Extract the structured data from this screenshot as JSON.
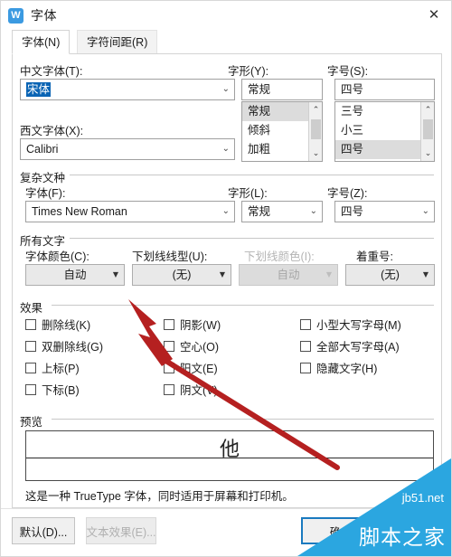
{
  "window": {
    "title": "字体",
    "icon": "wps-writer-icon",
    "close_label": "✕"
  },
  "tabs": [
    {
      "label": "字体(N)",
      "active": true
    },
    {
      "label": "字符间距(R)",
      "active": false
    }
  ],
  "chinese_font": {
    "label": "中文字体(T):",
    "value": "宋体",
    "selected": true
  },
  "latin_font": {
    "label": "西文字体(X):",
    "value": "Calibri"
  },
  "font_style": {
    "label": "字形(Y):",
    "value": "常规",
    "options": [
      "常规",
      "倾斜",
      "加粗"
    ],
    "selected_index": 0
  },
  "font_size": {
    "label": "字号(S):",
    "value": "四号",
    "options": [
      "三号",
      "小三",
      "四号"
    ],
    "selected_index": 2
  },
  "complex_script": {
    "group_label": "复杂文种",
    "font": {
      "label": "字体(F):",
      "value": "Times New Roman"
    },
    "style": {
      "label": "字形(L):",
      "value": "常规"
    },
    "size": {
      "label": "字号(Z):",
      "value": "四号"
    }
  },
  "all_text": {
    "group_label": "所有文字",
    "font_color": {
      "label": "字体颜色(C):",
      "value": "自动",
      "disabled": false
    },
    "underline_style": {
      "label": "下划线线型(U):",
      "value": "(无)",
      "disabled": false
    },
    "underline_color": {
      "label": "下划线颜色(I):",
      "value": "自动",
      "disabled": true
    },
    "emphasis_mark": {
      "label": "着重号:",
      "value": "(无)",
      "disabled": false
    }
  },
  "effects": {
    "group_label": "效果",
    "column1": [
      {
        "label": "删除线(K)",
        "checked": false
      },
      {
        "label": "双删除线(G)",
        "checked": false
      },
      {
        "label": "上标(P)",
        "checked": false
      },
      {
        "label": "下标(B)",
        "checked": false
      }
    ],
    "column2": [
      {
        "label": "阴影(W)",
        "checked": false
      },
      {
        "label": "空心(O)",
        "checked": false
      },
      {
        "label": "阳文(E)",
        "checked": false
      },
      {
        "label": "阴文(V)",
        "checked": false
      }
    ],
    "column3": [
      {
        "label": "小型大写字母(M)",
        "checked": false
      },
      {
        "label": "全部大写字母(A)",
        "checked": false
      },
      {
        "label": "隐藏文字(H)",
        "checked": false
      }
    ]
  },
  "preview": {
    "group_label": "预览",
    "sample_text": "他",
    "note": "这是一种 TrueType 字体，同时适用于屏幕和打印机。"
  },
  "footer": {
    "default_button": "默认(D)...",
    "text_effects_button": "文本效果(E)...",
    "ok_button": "确"
  },
  "watermark": {
    "site": "jb51.net",
    "name": "脚本之家",
    "color": "#2ba6e0"
  },
  "annotation": {
    "arrow_color": "#b52020",
    "description": "red-arrow-pointing-to-underline-style-dropdown"
  }
}
